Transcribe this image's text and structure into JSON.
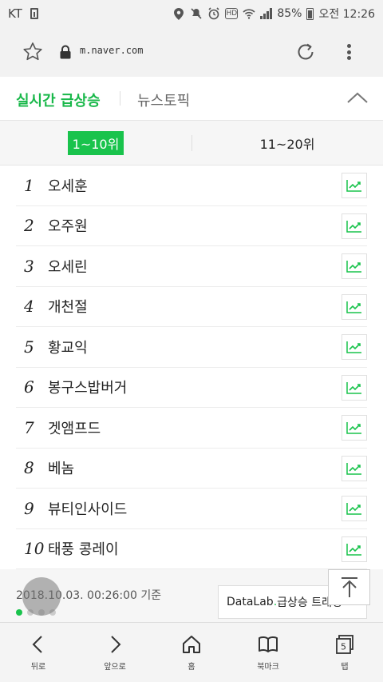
{
  "status_bar": {
    "carrier": "KT",
    "battery": "85%",
    "time": "오전 12:26",
    "hd_badge": "HD"
  },
  "browser": {
    "url": "m.naver.com"
  },
  "topic_tabs": {
    "active": "실시간 급상승",
    "inactive": "뉴스토픽"
  },
  "rank_tabs": {
    "tab1": "1~10위",
    "tab2": "11~20위"
  },
  "rankings": [
    {
      "rank": "1",
      "keyword": "오세훈"
    },
    {
      "rank": "2",
      "keyword": "오주원"
    },
    {
      "rank": "3",
      "keyword": "오세린"
    },
    {
      "rank": "4",
      "keyword": "개천절"
    },
    {
      "rank": "5",
      "keyword": "황교익"
    },
    {
      "rank": "6",
      "keyword": "봉구스밥버거"
    },
    {
      "rank": "7",
      "keyword": "겟앰프드"
    },
    {
      "rank": "8",
      "keyword": "베놈"
    },
    {
      "rank": "9",
      "keyword": "뷰티인사이드"
    },
    {
      "rank": "10",
      "keyword": "태풍 콩레이"
    }
  ],
  "footer": {
    "timestamp": "2018.10.03. 00:26:00 기준",
    "datalab_prefix": "DataLab",
    "datalab_dot": ".",
    "datalab_suffix": "급상승 트래킹"
  },
  "bottom_nav": [
    {
      "label": "뒤로",
      "icon": "back-icon"
    },
    {
      "label": "앞으로",
      "icon": "forward-icon"
    },
    {
      "label": "홈",
      "icon": "home-icon"
    },
    {
      "label": "북마크",
      "icon": "bookmark-icon"
    },
    {
      "label": "탭",
      "icon": "tabs-icon",
      "count": "5"
    }
  ],
  "colors": {
    "accent": "#19c34c",
    "accent_text": "#19b84a"
  }
}
